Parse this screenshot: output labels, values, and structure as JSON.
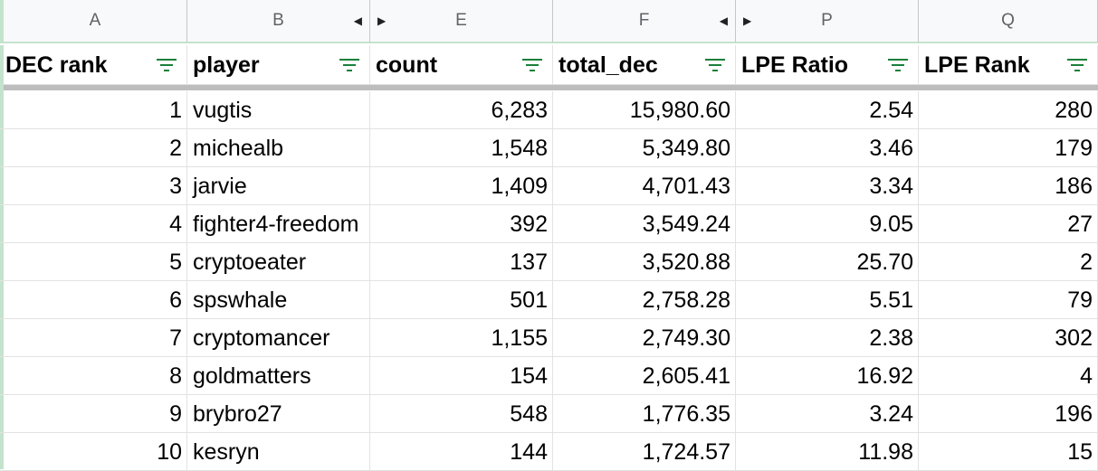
{
  "column_letters": [
    {
      "letter": "A",
      "arrow_left": false,
      "arrow_right": false
    },
    {
      "letter": "B",
      "arrow_left": true,
      "arrow_right": false
    },
    {
      "letter": "E",
      "arrow_left": false,
      "arrow_right": true
    },
    {
      "letter": "F",
      "arrow_left": true,
      "arrow_right": false
    },
    {
      "letter": "P",
      "arrow_left": false,
      "arrow_right": true
    },
    {
      "letter": "Q",
      "arrow_left": false,
      "arrow_right": false
    }
  ],
  "headers": [
    "DEC rank",
    "player",
    "count",
    "total_dec",
    "LPE Ratio",
    "LPE Rank"
  ],
  "rows": [
    [
      "1",
      "vugtis",
      "6,283",
      "15,980.60",
      "2.54",
      "280"
    ],
    [
      "2",
      "michealb",
      "1,548",
      "5,349.80",
      "3.46",
      "179"
    ],
    [
      "3",
      "jarvie",
      "1,409",
      "4,701.43",
      "3.34",
      "186"
    ],
    [
      "4",
      "fighter4-freedom",
      "392",
      "3,549.24",
      "9.05",
      "27"
    ],
    [
      "5",
      "cryptoeater",
      "137",
      "3,520.88",
      "25.70",
      "2"
    ],
    [
      "6",
      "spswhale",
      "501",
      "2,758.28",
      "5.51",
      "79"
    ],
    [
      "7",
      "cryptomancer",
      "1,155",
      "2,749.30",
      "2.38",
      "302"
    ],
    [
      "8",
      "goldmatters",
      "154",
      "2,605.41",
      "16.92",
      "4"
    ],
    [
      "9",
      "brybro27",
      "548",
      "1,776.35",
      "3.24",
      "196"
    ],
    [
      "10",
      "kesryn",
      "144",
      "1,724.57",
      "11.98",
      "15"
    ]
  ],
  "colors": {
    "filter_icon": "#188038",
    "header_border": "#c4e3cc",
    "freeze_bar": "#bdbdbd"
  }
}
